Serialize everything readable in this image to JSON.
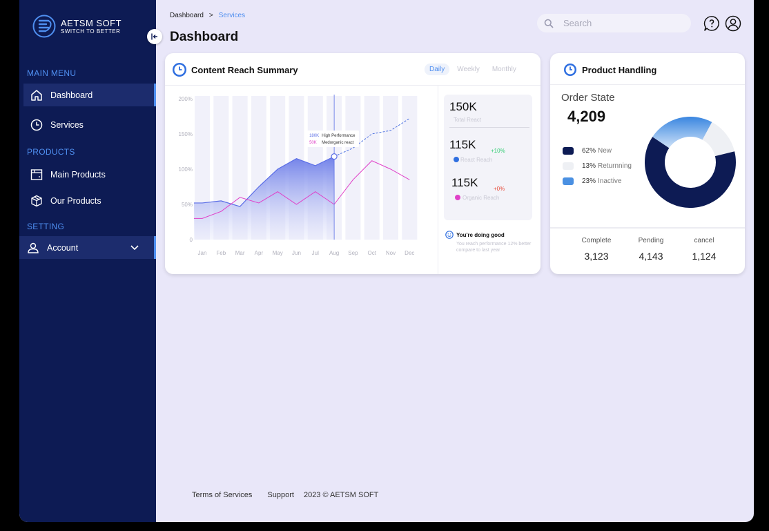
{
  "brand": {
    "name": "AETSM SOFT",
    "tagline": "SWITCH TO BETTER"
  },
  "sidebar": {
    "sections": [
      {
        "label": "MAIN MENU"
      },
      {
        "label": "PRODUCTS"
      },
      {
        "label": "SETTING"
      }
    ],
    "items": [
      {
        "label": "Dashboard",
        "icon": "home-icon",
        "active": true
      },
      {
        "label": "Services",
        "icon": "clock-icon",
        "active": false
      },
      {
        "label": "Main Products",
        "icon": "box-icon",
        "active": false
      },
      {
        "label": "Our Products",
        "icon": "package-icon",
        "active": false
      },
      {
        "label": "Account",
        "icon": "user-icon",
        "active": false
      }
    ]
  },
  "breadcrumb": {
    "root": "Dashboard",
    "sep": ">",
    "current": "Services"
  },
  "page": {
    "title": "Dashboard"
  },
  "search": {
    "placeholder": "Search"
  },
  "reach": {
    "title": "Content Reach Summary",
    "tabs": [
      {
        "label": "Daily",
        "active": true
      },
      {
        "label": "Weekly"
      },
      {
        "label": "Monthly"
      }
    ],
    "stats": {
      "total_value": "150K",
      "total_label": "Total React",
      "react_value": "115K",
      "react_delta": "+10%",
      "react_label": "React Reach",
      "organic_value": "115K",
      "organic_delta": "+0%",
      "organic_label": "Organic Reach"
    },
    "note": {
      "title": "You're doing good",
      "text": "You reach performance 12% better compare to last year"
    }
  },
  "chart_data": {
    "type": "line",
    "categories": [
      "Jan",
      "Feb",
      "Mar",
      "Apr",
      "May",
      "Jun",
      "Jul",
      "Aug",
      "Sep",
      "Oct",
      "Nov",
      "Dec"
    ],
    "yticks": [
      "0",
      "50%",
      "100%",
      "150%",
      "200%"
    ],
    "ylim": [
      0,
      200
    ],
    "series": [
      {
        "name": "High Performance",
        "values": [
          52,
          55,
          47,
          75,
          100,
          115,
          105,
          118,
          130,
          150,
          155,
          172
        ],
        "color": "#5b6ee6",
        "projected_from_index": 7
      },
      {
        "name": "Medorganic react",
        "values": [
          30,
          40,
          60,
          52,
          68,
          50,
          68,
          50,
          85,
          112,
          100,
          85
        ],
        "color": "#e040c8"
      }
    ],
    "tooltip": {
      "index": 7,
      "rows": [
        {
          "value": "180K",
          "label": "High Performance"
        },
        {
          "value": "50K",
          "label": "Medorganic react"
        }
      ]
    }
  },
  "product": {
    "title": "Product Handling",
    "order_label": "Order State",
    "order_value": "4,209",
    "legend": [
      {
        "pct": "62%",
        "label": "New",
        "color": "#0d1b54",
        "value": 62
      },
      {
        "pct": "13%",
        "label": "Returnning",
        "color": "#eef0f4",
        "value": 13
      },
      {
        "pct": "23%",
        "label": "Inactive",
        "color": "#4a90e2",
        "value": 23
      }
    ],
    "bottom": [
      {
        "label": "Complete",
        "value": "3,123"
      },
      {
        "label": "Pending",
        "value": "4,143"
      },
      {
        "label": "cancel",
        "value": "1,124"
      }
    ]
  },
  "footer": {
    "terms": "Terms of Services",
    "support": "Support",
    "copyright": "2023 © AETSM SOFT"
  }
}
